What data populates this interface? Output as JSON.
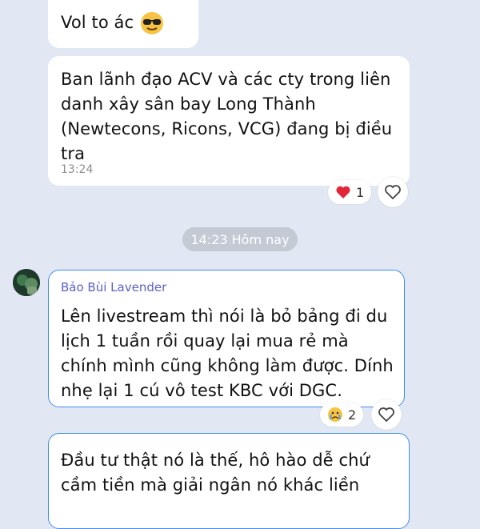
{
  "messages": [
    {
      "text": "Vol to ác",
      "emoji": "sunglasses-face"
    },
    {
      "text": "Ban lãnh đạo ACV và các cty trong liên danh xây sân bay Long Thành (Newtecons, Ricons, VCG) đang bị điều tra",
      "time": "13:24",
      "reaction": {
        "icon": "heart",
        "count": "1",
        "color": "#e0273a"
      }
    },
    {
      "sender": "Bảo Bùi Lavender",
      "text": "Lên livestream thì nói là bỏ bảng đi du lịch 1 tuần rồi quay lại mua rẻ mà chính mình cũng không làm được. Dính nhẹ lại 1 cú vô test KBC với DGC.",
      "reaction": {
        "icon": "crying-face",
        "count": "2"
      }
    },
    {
      "text": "Đầu tư thật nó là thế, hô hào dễ chứ cầm tiền mà giải ngân nó khác liền"
    }
  ],
  "date_separator": "14:23 Hôm nay",
  "colors": {
    "background": "#e2e8f3",
    "highlight_border": "#3f8cf0",
    "sender_name": "#5b5fc7"
  }
}
